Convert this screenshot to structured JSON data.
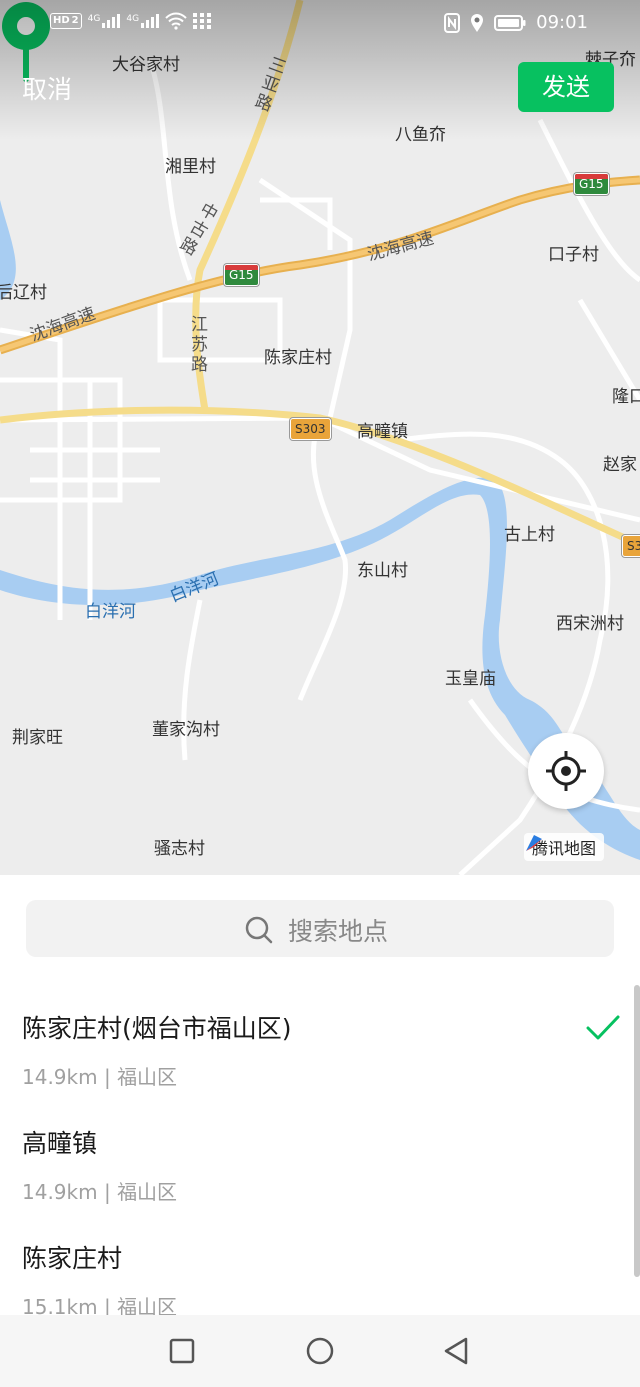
{
  "status_bar": {
    "left_icons": [
      "hd-icon",
      "signal-4g-icon",
      "signal-4g-icon",
      "wifi-icon",
      "apps-grid-icon"
    ],
    "hd_label": "HD",
    "sim_label": "2",
    "net1": "4G",
    "net2": "4G",
    "time": "09:01",
    "right_icons": [
      "nfc-icon",
      "location-icon",
      "battery-icon"
    ]
  },
  "header": {
    "cancel_label": "取消",
    "send_label": "发送",
    "send_color": "#07c160"
  },
  "map": {
    "places": [
      {
        "id": "dagujia",
        "text": "大谷家村"
      },
      {
        "id": "bayujie",
        "text": "八鱼夼"
      },
      {
        "id": "xiangli",
        "text": "湘里村"
      },
      {
        "id": "kouzi",
        "text": "口子村"
      },
      {
        "id": "houliao",
        "text": "后辽村"
      },
      {
        "id": "chenjiazhuang",
        "text": "陈家庄村"
      },
      {
        "id": "gaotong",
        "text": "高疃镇"
      },
      {
        "id": "long",
        "text": "隆口"
      },
      {
        "id": "zhaojia",
        "text": "赵家"
      },
      {
        "id": "gushang",
        "text": "古上村"
      },
      {
        "id": "dongshan",
        "text": "东山村"
      },
      {
        "id": "xisongzhou",
        "text": "西宋洲村"
      },
      {
        "id": "yuhuang",
        "text": "玉皇庙"
      },
      {
        "id": "jingjiawang",
        "text": "荆家旺"
      },
      {
        "id": "dongjiagou",
        "text": "董家沟村"
      },
      {
        "id": "saozhi",
        "text": "骚志村"
      },
      {
        "id": "jizi",
        "text": "棘子夼"
      }
    ],
    "roads": {
      "sanya": "三亚路",
      "zhonggu": "中古路",
      "jiangsu": "江苏路",
      "shenhai": "沈海高速"
    },
    "river": "白洋河",
    "shields": {
      "g15": "G15",
      "s303": "S303",
      "s3": "S3"
    },
    "brand": "腾讯地图",
    "locate_icon": "crosshair-icon",
    "pin_icon": "map-pin-icon",
    "pin_color": "#07c160"
  },
  "search": {
    "placeholder": "搜索地点",
    "icon": "search-icon"
  },
  "results": [
    {
      "title": "陈家庄村(烟台市福山区)",
      "distance": "14.9km",
      "area": "福山区",
      "selected": true
    },
    {
      "title": "高疃镇",
      "distance": "14.9km",
      "area": "福山区",
      "selected": false
    },
    {
      "title": "陈家庄村",
      "distance": "15.1km",
      "area": "福山区",
      "selected": false
    }
  ],
  "nav_bar": [
    "recents-square-icon",
    "home-circle-icon",
    "back-triangle-icon"
  ]
}
